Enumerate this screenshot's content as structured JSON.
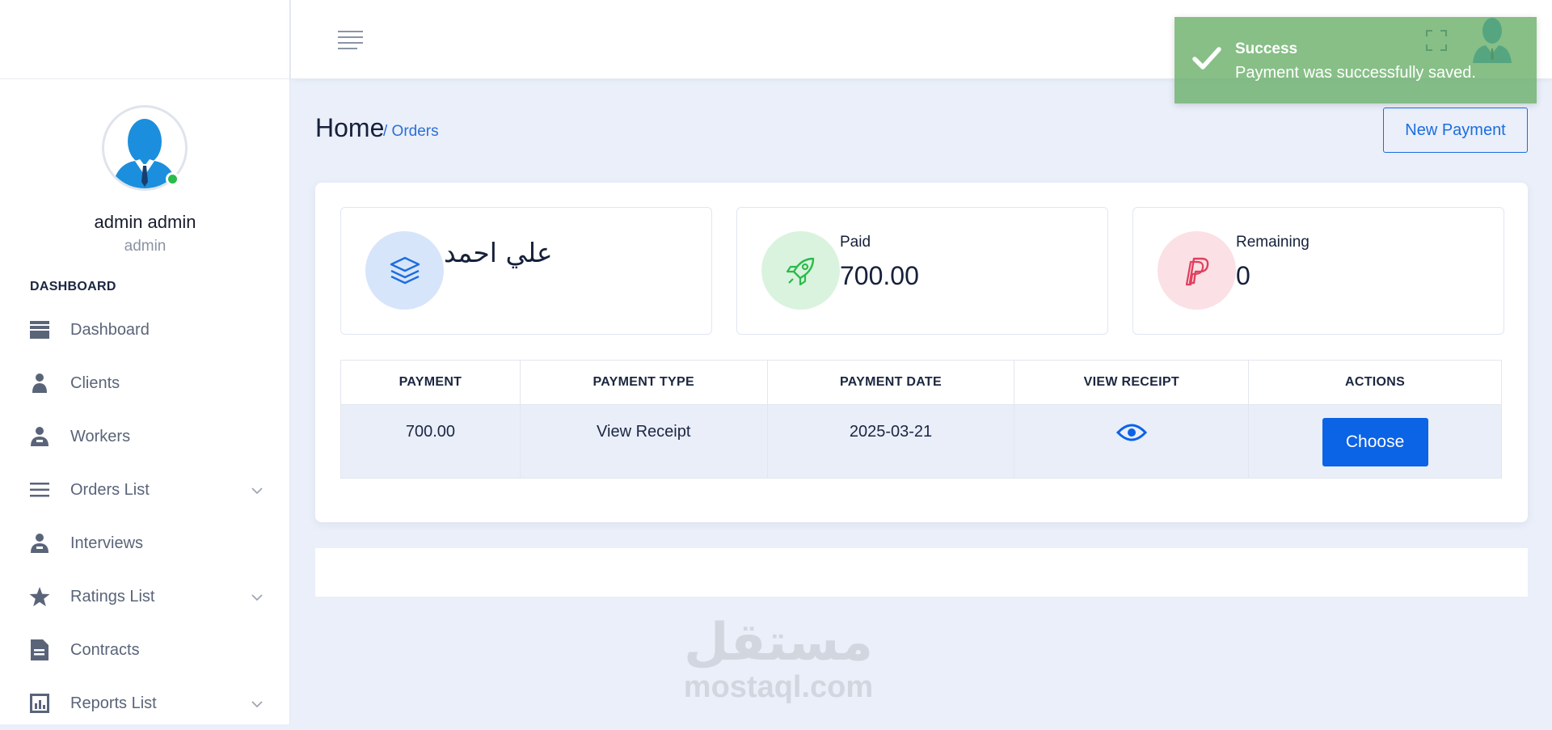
{
  "user": {
    "name": "admin admin",
    "role": "admin"
  },
  "sidebar": {
    "section_title": "DASHBOARD",
    "items": [
      {
        "label": "Dashboard",
        "icon": "dashboard-icon",
        "has_submenu": false
      },
      {
        "label": "Clients",
        "icon": "user-icon",
        "has_submenu": false
      },
      {
        "label": "Workers",
        "icon": "worker-icon",
        "has_submenu": false
      },
      {
        "label": "Orders List",
        "icon": "list-icon",
        "has_submenu": true
      },
      {
        "label": "Interviews",
        "icon": "worker-icon",
        "has_submenu": false
      },
      {
        "label": "Ratings List",
        "icon": "star-icon",
        "has_submenu": true
      },
      {
        "label": "Contracts",
        "icon": "document-icon",
        "has_submenu": false
      },
      {
        "label": "Reports List",
        "icon": "chart-icon",
        "has_submenu": true
      }
    ]
  },
  "toast": {
    "title": "Success",
    "message": "Payment was successfully saved.",
    "color": "#65ad65"
  },
  "header": {
    "title": "Home",
    "breadcrumb": "/ Orders",
    "new_payment_label": "New Payment"
  },
  "stats": {
    "client": {
      "name": "علي احمد",
      "icon": "layers-icon",
      "color": "#1b6ddf"
    },
    "paid": {
      "label": "Paid",
      "value": "700.00",
      "icon": "rocket-icon",
      "color": "#2bbb4b"
    },
    "remaining": {
      "label": "Remaining",
      "value": "0",
      "icon": "paypal-icon",
      "color": "#e0405e"
    }
  },
  "table": {
    "headers": [
      "PAYMENT",
      "PAYMENT TYPE",
      "PAYMENT DATE",
      "VIEW RECEIPT",
      "ACTIONS"
    ],
    "rows": [
      {
        "payment": "700.00",
        "payment_type": "View Receipt",
        "payment_date": "2025-03-21",
        "action_label": "Choose"
      }
    ]
  },
  "watermark": {
    "arabic": "مستقل",
    "domain": "mostaql.com"
  },
  "colors": {
    "accent": "#0b63e5",
    "background": "#eaeff9"
  }
}
